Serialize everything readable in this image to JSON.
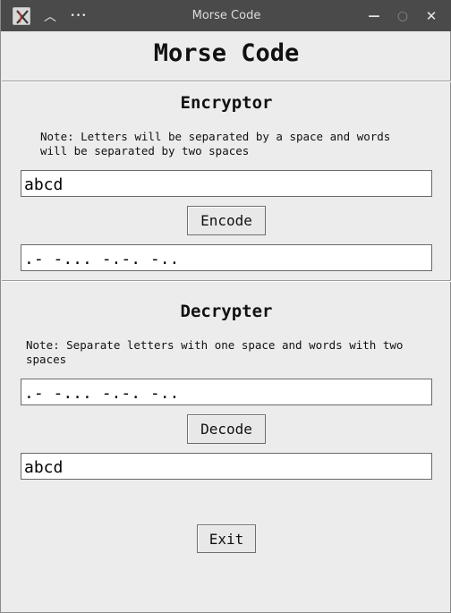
{
  "window": {
    "title": "Morse Code",
    "icons": {
      "app": "app-icon",
      "shade": "chevron-up-icon",
      "menu": "more-icon",
      "minimize": "minimize-icon",
      "maximize": "maximize-icon",
      "close": "close-icon"
    },
    "glyphs": {
      "shade": "︿",
      "menu": "•••",
      "minimize": "—",
      "maximize": "○",
      "close": "✕"
    }
  },
  "heading": "Morse Code",
  "encryptor": {
    "title": "Encryptor",
    "note": "Note: Letters will be separated by a space and words\nwill be separated by two spaces",
    "input_value": "abcd",
    "button_label": "Encode",
    "output_value": ".- -... -.-. -.."
  },
  "decrypter": {
    "title": "Decrypter",
    "note": "Note: Separate letters with one space and words with two\nspaces",
    "input_value": ".- -... -.-. -..",
    "button_label": "Decode",
    "output_value": "abcd"
  },
  "exit_label": "Exit",
  "colors": {
    "titlebar": "#4a4a4a",
    "background": "#ececec",
    "field": "#ffffff"
  }
}
